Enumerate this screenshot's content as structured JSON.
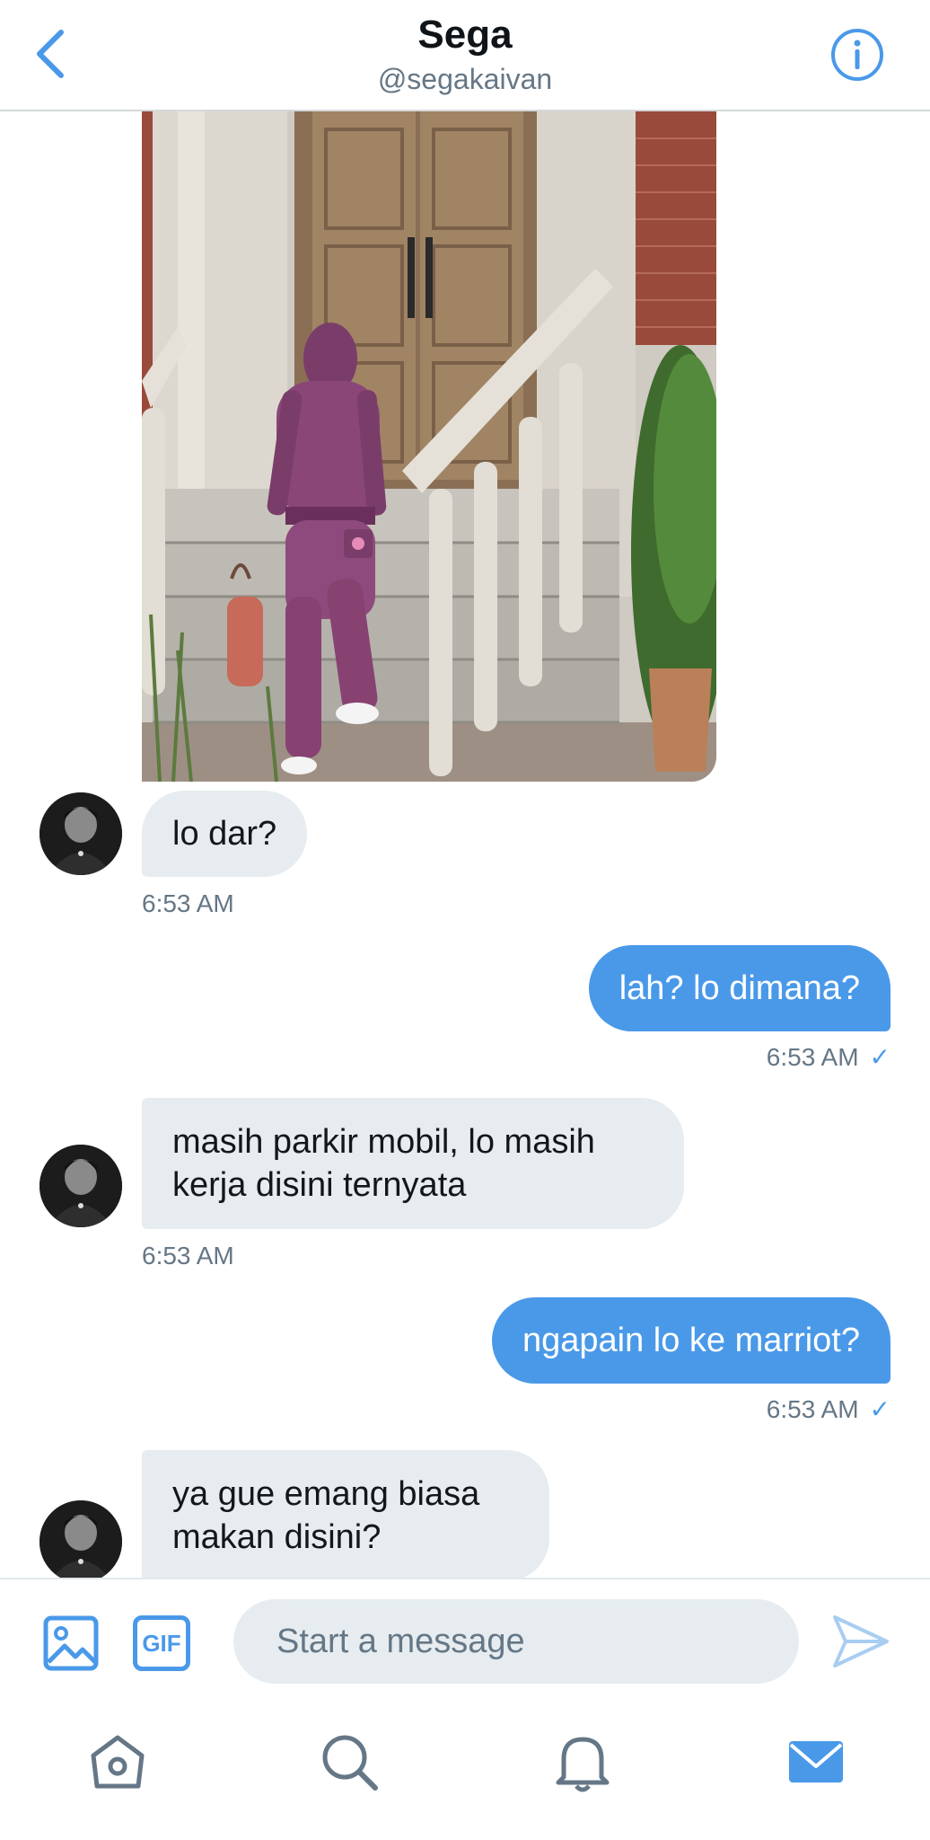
{
  "header": {
    "title": "Sega",
    "handle": "@segakaivan",
    "back_icon": "chevron-left-icon",
    "info_icon": "info-icon"
  },
  "colors": {
    "accent": "#4a99e9",
    "incoming_bubble": "#e6ecf0",
    "outgoing_bubble": "#4a99e9",
    "timestamp": "#657786"
  },
  "messages": [
    {
      "direction": "in",
      "type": "image"
    },
    {
      "direction": "in",
      "text": "lo dar?",
      "time": "6:53 AM"
    },
    {
      "direction": "out",
      "text": "lah? lo dimana?",
      "time": "6:53 AM",
      "read_mark": "✓"
    },
    {
      "direction": "in",
      "text": "masih parkir mobil, lo masih kerja disini ternyata",
      "time": "6:53 AM"
    },
    {
      "direction": "out",
      "text": "ngapain lo ke marriot?",
      "time": "6:53 AM",
      "read_mark": "✓"
    },
    {
      "direction": "in",
      "text": "ya gue emang biasa makan disini?"
    }
  ],
  "composer": {
    "media_icon": "image-icon",
    "gif_label": "GIF",
    "placeholder": "Start a message",
    "send_icon": "send-icon"
  },
  "tabbar": {
    "items": [
      {
        "name": "home",
        "icon": "home-icon",
        "active": false
      },
      {
        "name": "search",
        "icon": "search-icon",
        "active": false
      },
      {
        "name": "notifications",
        "icon": "bell-icon",
        "active": false
      },
      {
        "name": "messages",
        "icon": "mail-icon",
        "active": true
      }
    ]
  }
}
